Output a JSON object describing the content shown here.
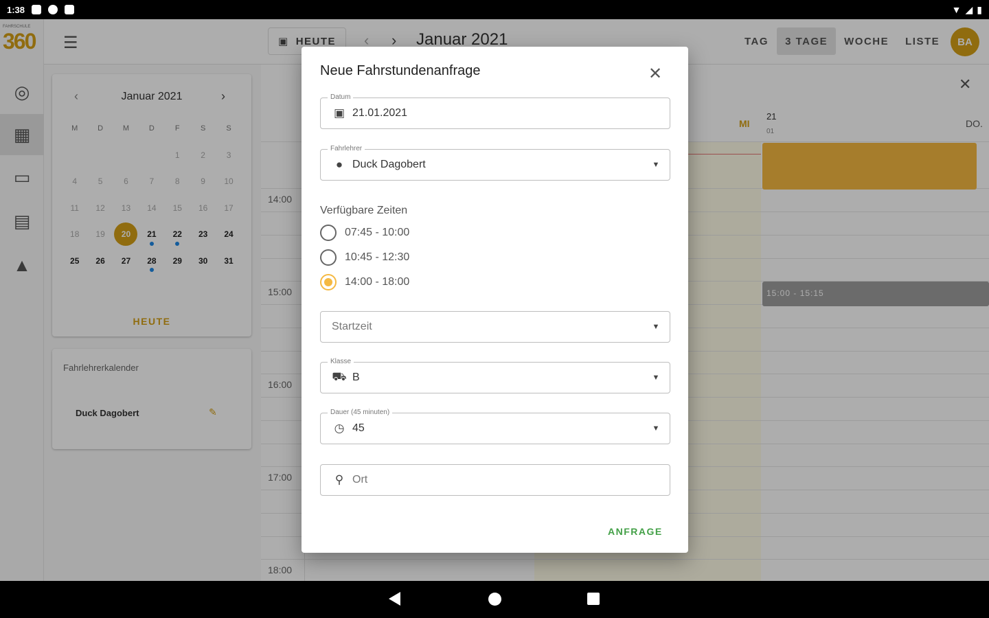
{
  "status_bar": {
    "time": "1:38"
  },
  "rail": {
    "logo_small": "FAHRSCHULE",
    "logo_big": "360",
    "items": [
      "dashboard",
      "calendar",
      "chat",
      "clipboard",
      "graduation"
    ]
  },
  "topbar": {
    "today_label": "HEUTE",
    "month_title": "Januar 2021",
    "views": [
      "TAG",
      "3 TAGE",
      "WOCHE",
      "LISTE"
    ],
    "active_view": "3 TAGE",
    "avatar_initials": "BA"
  },
  "mini_calendar": {
    "title": "Januar 2021",
    "weekdays": [
      "M",
      "D",
      "M",
      "D",
      "F",
      "S",
      "S"
    ],
    "today_link": "HEUTE",
    "today_day": "20"
  },
  "instructor_calendar": {
    "title": "Fahrlehrerkalender",
    "name": "Duck Dagobert"
  },
  "calendar": {
    "hours": [
      "14:00",
      "15:00",
      "16:00",
      "17:00",
      "18:00"
    ],
    "day_mi": "MI",
    "day_21": "21",
    "day_21_month": "01",
    "day_do": "DO.",
    "event_gray": "15:00 - 15:15"
  },
  "dialog": {
    "title": "Neue Fahrstundenanfrage",
    "date": {
      "label": "Datum",
      "value": "21.01.2021"
    },
    "instructor": {
      "label": "Fahrlehrer",
      "value": "Duck Dagobert"
    },
    "times_title": "Verfügbare Zeiten",
    "times": [
      {
        "label": "07:45 - 10:00",
        "checked": false
      },
      {
        "label": "10:45 - 12:30",
        "checked": false
      },
      {
        "label": "14:00 - 18:00",
        "checked": true
      }
    ],
    "start_time": {
      "placeholder": "Startzeit"
    },
    "class": {
      "label": "Klasse",
      "value": "B"
    },
    "duration": {
      "label": "Dauer (45 minuten)",
      "value": "45"
    },
    "location": {
      "placeholder": "Ort"
    },
    "submit_label": "ANFRAGE"
  },
  "colors": {
    "accent": "#d4a017",
    "radio_selected": "#f5b942",
    "submit": "#43a047",
    "event_dot": "#1e88e5"
  }
}
